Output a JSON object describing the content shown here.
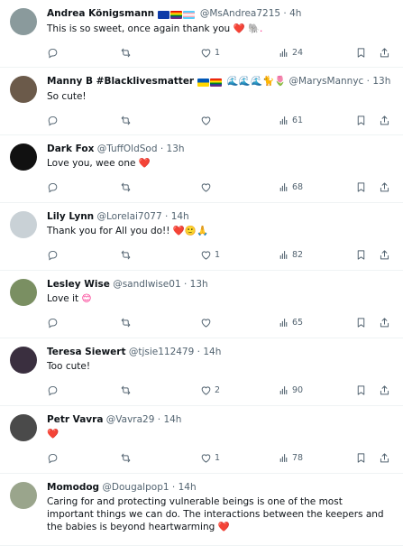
{
  "tweets": [
    {
      "name": "Andrea Königsmann",
      "flags": [
        "eu",
        "lgbt",
        "trans"
      ],
      "handle": "@MsAndrea7215",
      "sep": "·",
      "time": "4h",
      "text": "This is so sweet, once again thank you",
      "emoji": "❤️ 🐘.",
      "replies": "",
      "retweets": "",
      "likes": "1",
      "views": "24",
      "avatar_color": "#8a9a9c"
    },
    {
      "name": "Manny B #Blacklivesmatter",
      "flags": [
        "ua",
        "lgbt"
      ],
      "handle": "@MarysMannyc",
      "extra": "🌊🌊🌊🐈🌷",
      "sep": "·",
      "time": "13h",
      "text": "So cute!",
      "emoji": "",
      "replies": "",
      "retweets": "",
      "likes": "",
      "views": "61",
      "avatar_color": "#6b5a4a"
    },
    {
      "name": "Dark Fox",
      "flags": [],
      "handle": "@TuffOldSod",
      "sep": "·",
      "time": "13h",
      "text": "Love you,  wee one",
      "emoji": "❤️",
      "replies": "",
      "retweets": "",
      "likes": "",
      "views": "68",
      "avatar_color": "#111111"
    },
    {
      "name": "Lily Lynn",
      "flags": [],
      "handle": "@Lorelai7077",
      "sep": "·",
      "time": "14h",
      "text": "Thank you for All you do!!",
      "emoji": "❤️🙂🙏",
      "replies": "",
      "retweets": "",
      "likes": "1",
      "views": "82",
      "avatar_color": "#c9d1d6"
    },
    {
      "name": "Lesley Wise",
      "flags": [],
      "handle": "@sandlwise01",
      "sep": "·",
      "time": "13h",
      "text": "Love it",
      "emoji": "😊",
      "replies": "",
      "retweets": "",
      "likes": "",
      "views": "65",
      "avatar_color": "#7a8f62"
    },
    {
      "name": "Teresa Siewert",
      "flags": [],
      "handle": "@tjsie112479",
      "sep": "·",
      "time": "14h",
      "text": "Too cute!",
      "emoji": "",
      "replies": "",
      "retweets": "",
      "likes": "2",
      "views": "90",
      "avatar_color": "#3a2f3f"
    },
    {
      "name": "Petr Vavra",
      "flags": [],
      "handle": "@Vavra29",
      "sep": "·",
      "time": "14h",
      "text": "",
      "emoji": "❤️",
      "replies": "",
      "retweets": "",
      "likes": "1",
      "views": "78",
      "avatar_color": "#4a4a4a"
    },
    {
      "name": "Momodog",
      "flags": [],
      "handle": "@Dougalpop1",
      "sep": "·",
      "time": "14h",
      "text": "Caring for and protecting vulnerable beings is one of the most important things we can do. The interactions between the keepers and the babies is beyond heartwarming",
      "emoji": "❤️",
      "replies": "",
      "retweets": "",
      "likes": "",
      "views": "",
      "avatar_color": "#9aa58c"
    }
  ],
  "colors": {
    "text": "#0f1419",
    "muted": "#536471",
    "border": "#eff3f4",
    "heart": "#f91880"
  },
  "icons": {
    "reply": "reply-icon",
    "retweet": "retweet-icon",
    "like": "like-icon",
    "views": "views-icon",
    "bookmark": "bookmark-icon",
    "share": "share-icon"
  }
}
